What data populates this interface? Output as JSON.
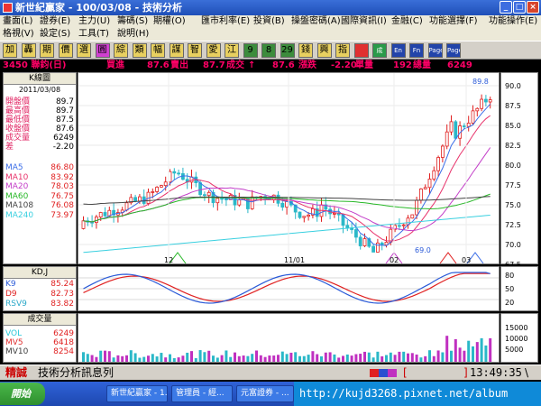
{
  "window": {
    "title": "新世紀贏家 - 100/03/08 - 技術分析"
  },
  "menu": {
    "row1": [
      "畫面(L)",
      "證券(E)",
      "主力(U)",
      "籌碼(S)",
      "期權(O)",
      "匯市利率(E)",
      "投資(B)",
      "操盤密碼(A)",
      "國際資訊(I)",
      "金融(C)",
      "功能選擇(F)",
      "功能操作(E)"
    ],
    "row2": [
      "格視(V)",
      "設定(S)",
      "工具(T)",
      "說明(H)"
    ]
  },
  "toolbar": {
    "buttons": [
      "加",
      "轟",
      "期",
      "價",
      "選",
      "圓",
      "綜",
      "類",
      "幅",
      "謀",
      "智",
      "愛",
      "江",
      "9",
      "8",
      "29",
      "錢",
      "興",
      "指",
      "",
      "成",
      "En",
      "Fn",
      "Page",
      "Page"
    ]
  },
  "stock": {
    "code_name": "3450 聯鈞(日)",
    "buy_label": "買進",
    "buy": "87.6",
    "sell_label": "賣出",
    "sell": "87.7",
    "last_label": "成交",
    "arrow": "↑",
    "last": "87.6",
    "chg_label": "漲跌",
    "chg": "-2.20",
    "lot_label": "單量",
    "lot": "192",
    "vol_label": "總量",
    "vol": "6249"
  },
  "left": {
    "title": "K線圖",
    "date": "2011/03/08",
    "rows": [
      {
        "l": "開盤價",
        "v": "89.7"
      },
      {
        "l": "最高價",
        "v": "89.7"
      },
      {
        "l": "最低價",
        "v": "87.5"
      },
      {
        "l": "收盤價",
        "v": "87.6"
      },
      {
        "l": "成交量",
        "v": "6249"
      },
      {
        "l": "差",
        "v": "-2.20"
      }
    ],
    "ma": [
      {
        "l": "MA5",
        "v": "86.80",
        "c": "#3b6ee8"
      },
      {
        "l": "MA10",
        "v": "83.92",
        "c": "#e8336b"
      },
      {
        "l": "MA20",
        "v": "78.03",
        "c": "#c33ec8"
      },
      {
        "l": "MA60",
        "v": "76.75",
        "c": "#28b828"
      },
      {
        "l": "MA108",
        "v": "76.08",
        "c": "#444444"
      },
      {
        "l": "MA240",
        "v": "73.97",
        "c": "#3ad0e0"
      }
    ]
  },
  "price_axis": [
    "90.0",
    "87.5",
    "85.0",
    "82.5",
    "80.0",
    "77.5",
    "75.0",
    "72.5",
    "70.0",
    "67.5"
  ],
  "chart_labels": {
    "high": "89.8",
    "low": "69.0",
    "months": [
      "12",
      "11/01",
      "02",
      "03"
    ]
  },
  "kd": {
    "title": "KD,J",
    "rows": [
      {
        "l": "K9",
        "v": "85.24",
        "c": "#2a5ad8"
      },
      {
        "l": "D9",
        "v": "82.73",
        "c": "#e02020"
      },
      {
        "l": "RSV9",
        "v": "83.82",
        "c": "#2aa8c8"
      }
    ],
    "axis": [
      "80",
      "50",
      "20"
    ]
  },
  "volume": {
    "title": "成交量",
    "rows": [
      {
        "l": "VOL",
        "v": "6249",
        "c": "#28c8d8"
      },
      {
        "l": "MV5",
        "v": "6418",
        "c": "#e03030"
      },
      {
        "l": "MV10",
        "v": "8254",
        "c": "#404040"
      }
    ],
    "axis": [
      "15000",
      "10000",
      "5000"
    ]
  },
  "status": {
    "left": "精誠",
    "center": "技術分析訊息列",
    "time": "13:49:35"
  },
  "taskbar": {
    "start": "開始",
    "tasks": [
      "新世紀贏家 - 1...",
      "管理員 - 經...",
      "元富證券 - ..."
    ],
    "url": "http://kujd3268.pixnet.net/album"
  }
}
